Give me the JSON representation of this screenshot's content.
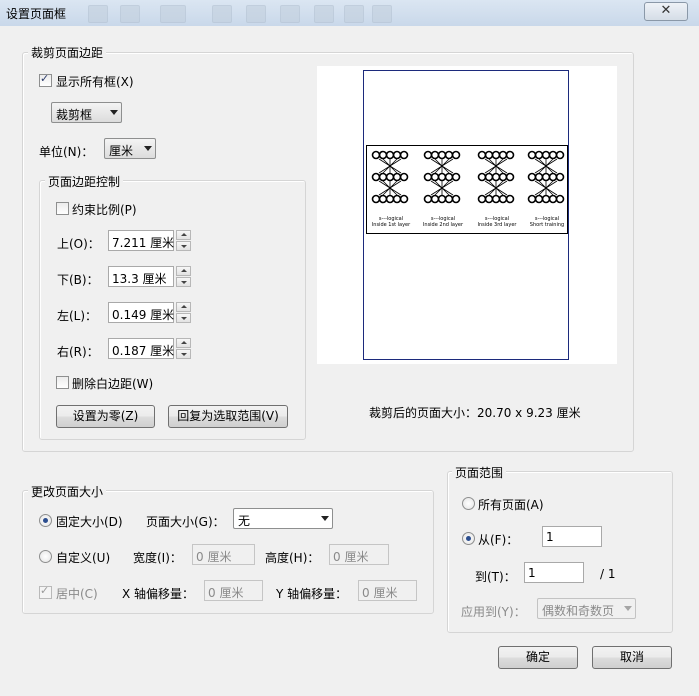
{
  "window": {
    "title": "设置页面框",
    "close_glyph": "✕"
  },
  "crop_margins": {
    "legend": "裁剪页面边距",
    "show_all_boxes": {
      "label": "显示所有框(X)",
      "checked": true
    },
    "box_type": "裁剪框",
    "unit_label": "单位(N)：",
    "unit_value": "厘米",
    "margin_control": {
      "legend": "页面边距控制",
      "constrain": {
        "label": "约束比例(P)",
        "checked": false
      },
      "top": {
        "label": "上(O)：",
        "value": "7.211 厘米"
      },
      "bottom": {
        "label": "下(B)：",
        "value": "13.3 厘米"
      },
      "left": {
        "label": "左(L)：",
        "value": "0.149 厘米"
      },
      "right": {
        "label": "右(R)：",
        "value": "0.187 厘米"
      },
      "remove_white": {
        "label": "删除白边距(W)",
        "checked": false
      },
      "set_zero_button": "设置为零(Z)",
      "revert_button": "回复为选取范围(V)"
    },
    "preview": {
      "captions": [
        [
          "s---logical",
          "Inside 1st layer"
        ],
        [
          "s---logical",
          "Inside 2nd layer"
        ],
        [
          "s---logical",
          "Inside 3rd layer"
        ],
        [
          "s---logical",
          "Short training"
        ]
      ]
    },
    "cropped_size_text": "裁剪后的页面大小：20.70 x 9.23 厘米"
  },
  "change_page_size": {
    "legend": "更改页面大小",
    "fixed_size": {
      "label": "固定大小(D)",
      "selected": true
    },
    "page_size_label": "页面大小(G)：",
    "page_size_value": "无",
    "custom": {
      "label": "自定义(U)",
      "selected": false
    },
    "width_label": "宽度(I)：",
    "width_value": "0 厘米",
    "height_label": "高度(H)：",
    "height_value": "0 厘米",
    "center": {
      "label": "居中(C)",
      "checked": true
    },
    "x_offset_label": "X 轴偏移量：",
    "x_offset_value": "0 厘米",
    "y_offset_label": "Y 轴偏移量：",
    "y_offset_value": "0 厘米"
  },
  "page_range": {
    "legend": "页面范围",
    "all_pages": {
      "label": "所有页面(A)",
      "selected": false
    },
    "from": {
      "label": "从(F)：",
      "selected": true,
      "value": "1"
    },
    "to": {
      "label": "到(T)：",
      "value": "1",
      "total": "/ 1"
    },
    "apply_to_label": "应用到(Y)：",
    "apply_to_value": "偶数和奇数页"
  },
  "footer": {
    "ok_button": "确定",
    "cancel_button": "取消"
  }
}
